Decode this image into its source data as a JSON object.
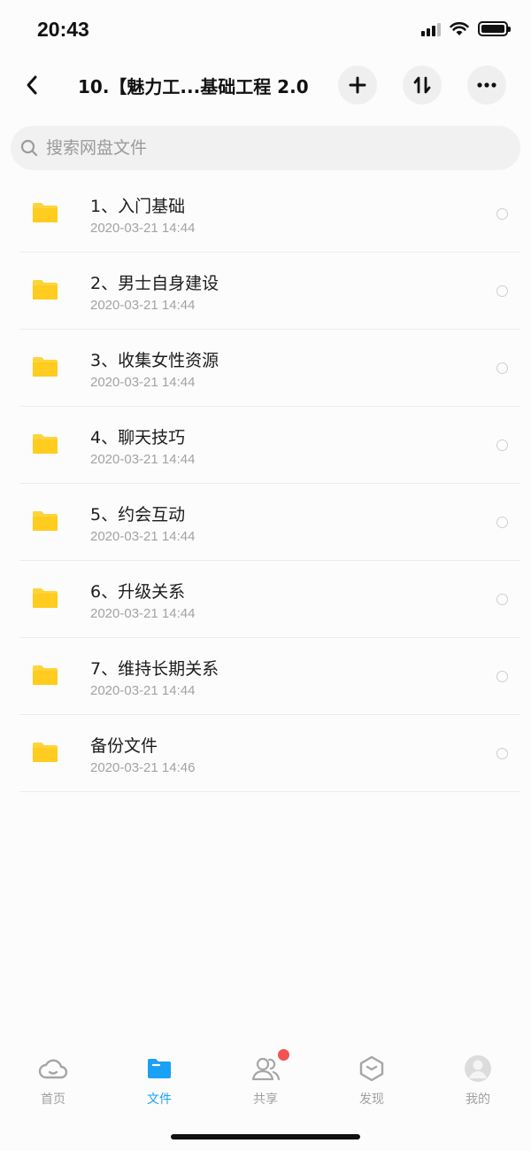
{
  "status": {
    "time": "20:43"
  },
  "header": {
    "title": "10.【魅力工...基础工程 2.0"
  },
  "search": {
    "placeholder": "搜索网盘文件"
  },
  "files": [
    {
      "name": "1、入门基础",
      "date": "2020-03-21 14:44"
    },
    {
      "name": "2、男士自身建设",
      "date": "2020-03-21 14:44"
    },
    {
      "name": "3、收集女性资源",
      "date": "2020-03-21 14:44"
    },
    {
      "name": "4、聊天技巧",
      "date": "2020-03-21 14:44"
    },
    {
      "name": "5、约会互动",
      "date": "2020-03-21 14:44"
    },
    {
      "name": "6、升级关系",
      "date": "2020-03-21 14:44"
    },
    {
      "name": "7、维持长期关系",
      "date": "2020-03-21 14:44"
    },
    {
      "name": "备份文件",
      "date": "2020-03-21 14:46"
    }
  ],
  "tabs": [
    {
      "label": "首页",
      "icon": "cloud-icon"
    },
    {
      "label": "文件",
      "icon": "folder-icon",
      "active": true
    },
    {
      "label": "共享",
      "icon": "people-icon",
      "badge": true
    },
    {
      "label": "发现",
      "icon": "discover-icon"
    },
    {
      "label": "我的",
      "icon": "avatar-icon"
    }
  ],
  "colors": {
    "accent": "#1aa0f5",
    "folder": "#ffd43b",
    "badge": "#f25353"
  }
}
